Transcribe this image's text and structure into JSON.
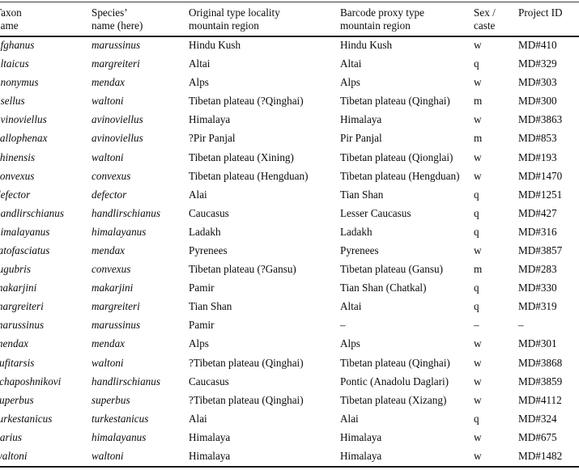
{
  "table": {
    "columns": [
      {
        "id": "taxon",
        "header_line1": "Taxon",
        "header_line2": "name"
      },
      {
        "id": "species",
        "header_line1": "Species’",
        "header_line2": "name (here)"
      },
      {
        "id": "orig",
        "header_line1": "Original type locality",
        "header_line2": "mountain region"
      },
      {
        "id": "proxy",
        "header_line1": "Barcode proxy type",
        "header_line2": "mountain region"
      },
      {
        "id": "sex",
        "header_line1": "Sex /",
        "header_line2": "caste"
      },
      {
        "id": "pid",
        "header_line1": "Project ID",
        "header_line2": ""
      }
    ],
    "rows": [
      {
        "taxon": "afghanus",
        "species": "marussinus",
        "orig": "Hindu Kush",
        "proxy": "Hindu Kush",
        "sex": "w",
        "pid": "MD#410"
      },
      {
        "taxon": "altaicus",
        "species": "margreiteri",
        "orig": "Altai",
        "proxy": "Altai",
        "sex": "q",
        "pid": "MD#329"
      },
      {
        "taxon": "anonymus",
        "species": "mendax",
        "orig": "Alps",
        "proxy": "Alps",
        "sex": "w",
        "pid": "MD#303"
      },
      {
        "taxon": "asellus",
        "species": "waltoni",
        "orig": "Tibetan plateau (?Qinghai)",
        "proxy": "Tibetan plateau (Qinghai)",
        "sex": "m",
        "pid": "MD#300"
      },
      {
        "taxon": "avinoviellus",
        "species": "avinoviellus",
        "orig": "Himalaya",
        "proxy": "Himalaya",
        "sex": "w",
        "pid": "MD#3863"
      },
      {
        "taxon": "callophenax",
        "species": "avinoviellus",
        "orig": "?Pir Panjal",
        "proxy": "Pir Panjal",
        "sex": "m",
        "pid": "MD#853"
      },
      {
        "taxon": "chinensis",
        "species": "waltoni",
        "orig": "Tibetan plateau (Xining)",
        "proxy": "Tibetan plateau (Qionglai)",
        "sex": "w",
        "pid": "MD#193"
      },
      {
        "taxon": "convexus",
        "species": "convexus",
        "orig": "Tibetan plateau (Hengduan)",
        "proxy": "Tibetan plateau (Hengduan)",
        "sex": "w",
        "pid": "MD#1470"
      },
      {
        "taxon": "defector",
        "species": "defector",
        "orig": "Alai",
        "proxy": "Tian Shan",
        "sex": "q",
        "pid": "MD#1251"
      },
      {
        "taxon": "handlirschianus",
        "species": "handlirschianus",
        "orig": "Caucasus",
        "proxy": "Lesser Caucasus",
        "sex": "q",
        "pid": "MD#427"
      },
      {
        "taxon": "himalayanus",
        "species": "himalayanus",
        "orig": "Ladakh",
        "proxy": "Ladakh",
        "sex": "q",
        "pid": "MD#316"
      },
      {
        "taxon": "latofasciatus",
        "species": "mendax",
        "orig": "Pyrenees",
        "proxy": "Pyrenees",
        "sex": "w",
        "pid": "MD#3857"
      },
      {
        "taxon": "lugubris",
        "species": "convexus",
        "orig": "Tibetan plateau (?Gansu)",
        "proxy": "Tibetan plateau (Gansu)",
        "sex": "m",
        "pid": "MD#283"
      },
      {
        "taxon": "makarjini",
        "species": "makarjini",
        "orig": "Pamir",
        "proxy": "Tian Shan (Chatkal)",
        "sex": "q",
        "pid": "MD#330"
      },
      {
        "taxon": "margreiteri",
        "species": "margreiteri",
        "orig": "Tian Shan",
        "proxy": "Altai",
        "sex": "q",
        "pid": "MD#319"
      },
      {
        "taxon": "marussinus",
        "species": "marussinus",
        "orig": "Pamir",
        "proxy": "–",
        "sex": "–",
        "pid": "–"
      },
      {
        "taxon": "mendax",
        "species": "mendax",
        "orig": "Alps",
        "proxy": "Alps",
        "sex": "w",
        "pid": "MD#301"
      },
      {
        "taxon": "rufitarsis",
        "species": "waltoni",
        "orig": "?Tibetan plateau (Qinghai)",
        "proxy": "Tibetan plateau (Qinghai)",
        "sex": "w",
        "pid": "MD#3868"
      },
      {
        "taxon": "schaposhnikovi",
        "species": "handlirschianus",
        "orig": "Caucasus",
        "proxy": "Pontic (Anadolu Daglari)",
        "sex": "w",
        "pid": "MD#3859"
      },
      {
        "taxon": "superbus",
        "species": "superbus",
        "orig": "?Tibetan plateau (Qinghai)",
        "proxy": "Tibetan plateau (Xizang)",
        "sex": "w",
        "pid": "MD#4112"
      },
      {
        "taxon": "turkestanicus",
        "species": "turkestanicus",
        "orig": "Alai",
        "proxy": "Alai",
        "sex": "q",
        "pid": "MD#324"
      },
      {
        "taxon": "varius",
        "species": "himalayanus",
        "orig": "Himalaya",
        "proxy": "Himalaya",
        "sex": "w",
        "pid": "MD#675"
      },
      {
        "taxon": "waltoni",
        "species": "waltoni",
        "orig": "Himalaya",
        "proxy": "Himalaya",
        "sex": "w",
        "pid": "MD#1482"
      }
    ]
  }
}
